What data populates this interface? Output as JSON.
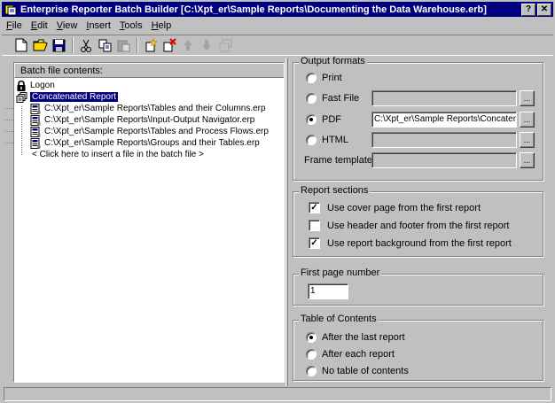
{
  "window": {
    "title": "Enterprise Reporter Batch Builder [C:\\Xpt_er\\Sample Reports\\Documenting the Data Warehouse.erb]",
    "help_btn": "?",
    "close_btn": "✕"
  },
  "menu": {
    "file": {
      "hot": "F",
      "rest": "ile"
    },
    "edit": {
      "hot": "E",
      "rest": "dit"
    },
    "view": {
      "hot": "V",
      "rest": "iew"
    },
    "insert": {
      "hot": "I",
      "rest": "nsert"
    },
    "tools": {
      "hot": "T",
      "rest": "ools"
    },
    "help": {
      "hot": "H",
      "rest": "elp"
    }
  },
  "batch": {
    "header": "Batch file contents:",
    "logon": "Logon",
    "concat": "Concatenated Report",
    "files": [
      "C:\\Xpt_er\\Sample Reports\\Tables and their Columns.erp",
      "C:\\Xpt_er\\Sample Reports\\Input-Output Navigator.erp",
      "C:\\Xpt_er\\Sample Reports\\Tables and Process Flows.erp",
      "C:\\Xpt_er\\Sample Reports\\Groups and their Tables.erp"
    ],
    "insert_hint": "< Click here to insert a file in the batch file >"
  },
  "output": {
    "legend": "Output formats",
    "print": "Print",
    "fastfile": "Fast File",
    "pdf": "PDF",
    "pdf_value": "C:\\Xpt_er\\Sample Reports\\Concaten",
    "html": "HTML",
    "frame": "Frame template",
    "browse": "...",
    "selected": "PDF"
  },
  "sections": {
    "legend": "Report sections",
    "cover": "Use cover page from the first report",
    "header_footer": "Use header and footer from the first report",
    "background": "Use report background from the first report",
    "check_mark": "✓"
  },
  "first_page": {
    "legend": "First page number",
    "value": "1"
  },
  "toc": {
    "legend": "Table of Contents",
    "after_last": "After the last report",
    "after_each": "After each report",
    "none": "No table of contents",
    "selected": "After the last report"
  },
  "colors": {
    "titlebar": "#000080",
    "face": "#c0c0c0",
    "selection": "#000080"
  }
}
